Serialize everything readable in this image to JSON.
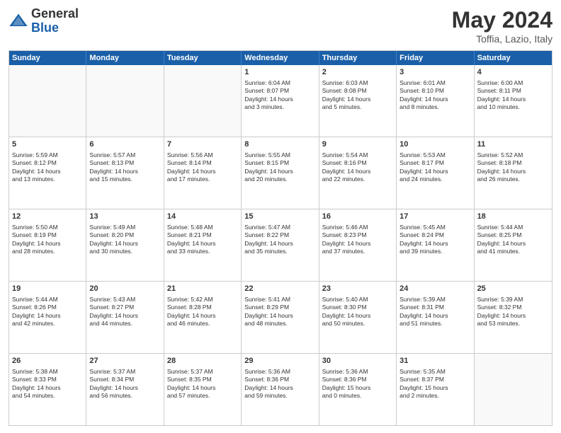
{
  "logo": {
    "general": "General",
    "blue": "Blue"
  },
  "header": {
    "month_year": "May 2024",
    "location": "Toffia, Lazio, Italy"
  },
  "weekdays": [
    "Sunday",
    "Monday",
    "Tuesday",
    "Wednesday",
    "Thursday",
    "Friday",
    "Saturday"
  ],
  "rows": [
    [
      {
        "day": "",
        "lines": []
      },
      {
        "day": "",
        "lines": []
      },
      {
        "day": "",
        "lines": []
      },
      {
        "day": "1",
        "lines": [
          "Sunrise: 6:04 AM",
          "Sunset: 8:07 PM",
          "Daylight: 14 hours",
          "and 3 minutes."
        ]
      },
      {
        "day": "2",
        "lines": [
          "Sunrise: 6:03 AM",
          "Sunset: 8:08 PM",
          "Daylight: 14 hours",
          "and 5 minutes."
        ]
      },
      {
        "day": "3",
        "lines": [
          "Sunrise: 6:01 AM",
          "Sunset: 8:10 PM",
          "Daylight: 14 hours",
          "and 8 minutes."
        ]
      },
      {
        "day": "4",
        "lines": [
          "Sunrise: 6:00 AM",
          "Sunset: 8:11 PM",
          "Daylight: 14 hours",
          "and 10 minutes."
        ]
      }
    ],
    [
      {
        "day": "5",
        "lines": [
          "Sunrise: 5:59 AM",
          "Sunset: 8:12 PM",
          "Daylight: 14 hours",
          "and 13 minutes."
        ]
      },
      {
        "day": "6",
        "lines": [
          "Sunrise: 5:57 AM",
          "Sunset: 8:13 PM",
          "Daylight: 14 hours",
          "and 15 minutes."
        ]
      },
      {
        "day": "7",
        "lines": [
          "Sunrise: 5:56 AM",
          "Sunset: 8:14 PM",
          "Daylight: 14 hours",
          "and 17 minutes."
        ]
      },
      {
        "day": "8",
        "lines": [
          "Sunrise: 5:55 AM",
          "Sunset: 8:15 PM",
          "Daylight: 14 hours",
          "and 20 minutes."
        ]
      },
      {
        "day": "9",
        "lines": [
          "Sunrise: 5:54 AM",
          "Sunset: 8:16 PM",
          "Daylight: 14 hours",
          "and 22 minutes."
        ]
      },
      {
        "day": "10",
        "lines": [
          "Sunrise: 5:53 AM",
          "Sunset: 8:17 PM",
          "Daylight: 14 hours",
          "and 24 minutes."
        ]
      },
      {
        "day": "11",
        "lines": [
          "Sunrise: 5:52 AM",
          "Sunset: 8:18 PM",
          "Daylight: 14 hours",
          "and 26 minutes."
        ]
      }
    ],
    [
      {
        "day": "12",
        "lines": [
          "Sunrise: 5:50 AM",
          "Sunset: 8:19 PM",
          "Daylight: 14 hours",
          "and 28 minutes."
        ]
      },
      {
        "day": "13",
        "lines": [
          "Sunrise: 5:49 AM",
          "Sunset: 8:20 PM",
          "Daylight: 14 hours",
          "and 30 minutes."
        ]
      },
      {
        "day": "14",
        "lines": [
          "Sunrise: 5:48 AM",
          "Sunset: 8:21 PM",
          "Daylight: 14 hours",
          "and 33 minutes."
        ]
      },
      {
        "day": "15",
        "lines": [
          "Sunrise: 5:47 AM",
          "Sunset: 8:22 PM",
          "Daylight: 14 hours",
          "and 35 minutes."
        ]
      },
      {
        "day": "16",
        "lines": [
          "Sunrise: 5:46 AM",
          "Sunset: 8:23 PM",
          "Daylight: 14 hours",
          "and 37 minutes."
        ]
      },
      {
        "day": "17",
        "lines": [
          "Sunrise: 5:45 AM",
          "Sunset: 8:24 PM",
          "Daylight: 14 hours",
          "and 39 minutes."
        ]
      },
      {
        "day": "18",
        "lines": [
          "Sunrise: 5:44 AM",
          "Sunset: 8:25 PM",
          "Daylight: 14 hours",
          "and 41 minutes."
        ]
      }
    ],
    [
      {
        "day": "19",
        "lines": [
          "Sunrise: 5:44 AM",
          "Sunset: 8:26 PM",
          "Daylight: 14 hours",
          "and 42 minutes."
        ]
      },
      {
        "day": "20",
        "lines": [
          "Sunrise: 5:43 AM",
          "Sunset: 8:27 PM",
          "Daylight: 14 hours",
          "and 44 minutes."
        ]
      },
      {
        "day": "21",
        "lines": [
          "Sunrise: 5:42 AM",
          "Sunset: 8:28 PM",
          "Daylight: 14 hours",
          "and 46 minutes."
        ]
      },
      {
        "day": "22",
        "lines": [
          "Sunrise: 5:41 AM",
          "Sunset: 8:29 PM",
          "Daylight: 14 hours",
          "and 48 minutes."
        ]
      },
      {
        "day": "23",
        "lines": [
          "Sunrise: 5:40 AM",
          "Sunset: 8:30 PM",
          "Daylight: 14 hours",
          "and 50 minutes."
        ]
      },
      {
        "day": "24",
        "lines": [
          "Sunrise: 5:39 AM",
          "Sunset: 8:31 PM",
          "Daylight: 14 hours",
          "and 51 minutes."
        ]
      },
      {
        "day": "25",
        "lines": [
          "Sunrise: 5:39 AM",
          "Sunset: 8:32 PM",
          "Daylight: 14 hours",
          "and 53 minutes."
        ]
      }
    ],
    [
      {
        "day": "26",
        "lines": [
          "Sunrise: 5:38 AM",
          "Sunset: 8:33 PM",
          "Daylight: 14 hours",
          "and 54 minutes."
        ]
      },
      {
        "day": "27",
        "lines": [
          "Sunrise: 5:37 AM",
          "Sunset: 8:34 PM",
          "Daylight: 14 hours",
          "and 56 minutes."
        ]
      },
      {
        "day": "28",
        "lines": [
          "Sunrise: 5:37 AM",
          "Sunset: 8:35 PM",
          "Daylight: 14 hours",
          "and 57 minutes."
        ]
      },
      {
        "day": "29",
        "lines": [
          "Sunrise: 5:36 AM",
          "Sunset: 8:36 PM",
          "Daylight: 14 hours",
          "and 59 minutes."
        ]
      },
      {
        "day": "30",
        "lines": [
          "Sunrise: 5:36 AM",
          "Sunset: 8:36 PM",
          "Daylight: 15 hours",
          "and 0 minutes."
        ]
      },
      {
        "day": "31",
        "lines": [
          "Sunrise: 5:35 AM",
          "Sunset: 8:37 PM",
          "Daylight: 15 hours",
          "and 2 minutes."
        ]
      },
      {
        "day": "",
        "lines": []
      }
    ]
  ]
}
